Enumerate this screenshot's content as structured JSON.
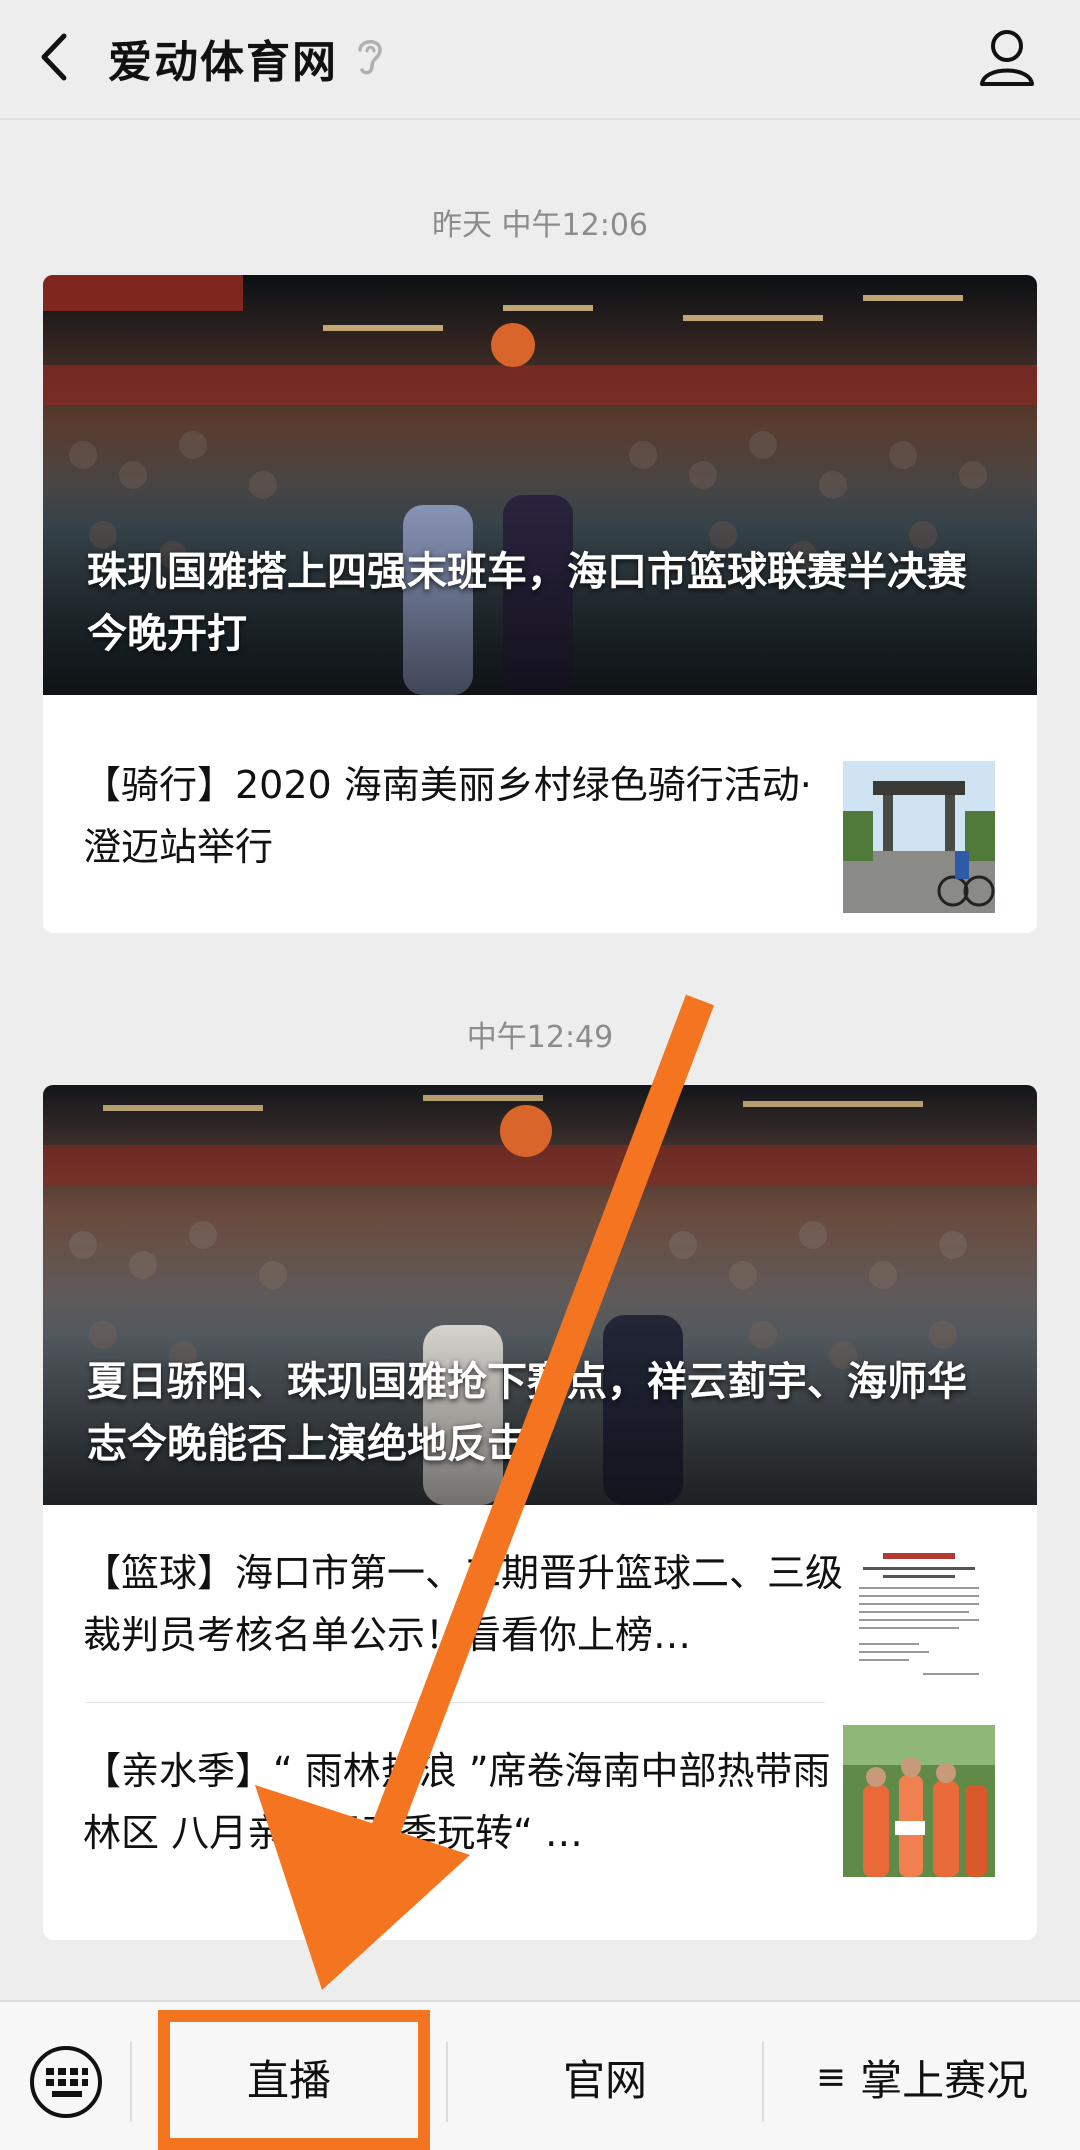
{
  "header": {
    "title": "爱动体育网",
    "back_icon": "chevron-left-icon",
    "ear_icon": "ear-icon",
    "profile_icon": "user-profile-icon"
  },
  "messages": [
    {
      "timestamp": "昨天 中午12:06",
      "main_title": "珠玑国雅搭上四强末班车，海口市篮球联赛半决赛今晚开打",
      "items": [
        {
          "title": "【骑行】2020 海南美丽乡村绿色骑行活动·澄迈站举行"
        }
      ]
    },
    {
      "timestamp": "中午12:49",
      "main_title": "夏日骄阳、珠玑国雅抢下赛点，祥云菿宇、海师华志今晚能否上演绝地反击？",
      "items": [
        {
          "title": "【篮球】海口市第一、二期晋升篮球二、三级裁判员考核名单公示！看看你上榜…"
        },
        {
          "title": "【亲水季】“ 雨林热浪 ”席卷海南中部热带雨林区 八月亲水运动季玩转“ …"
        }
      ]
    }
  ],
  "bottom_menu": {
    "keyboard_icon": "keyboard-icon",
    "items": [
      {
        "label": "直播"
      },
      {
        "label": "官网"
      },
      {
        "label": "掌上赛况",
        "prefix": "≡"
      }
    ]
  },
  "annotation": {
    "color": "#f47420"
  },
  "colors": {
    "background": "#ededed",
    "accent": "#f47420"
  }
}
